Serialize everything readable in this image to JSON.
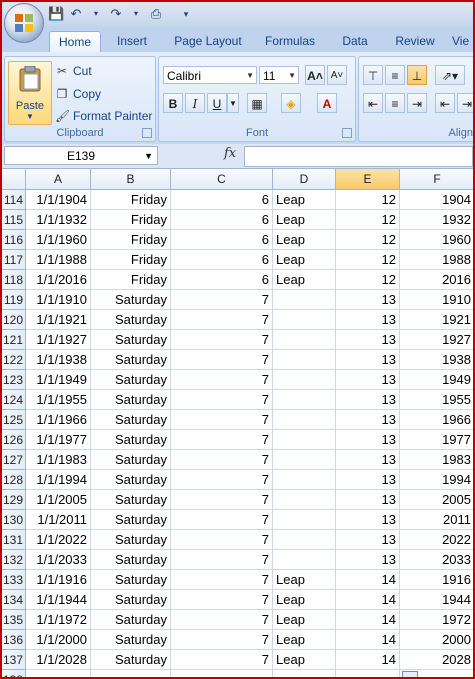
{
  "tabs": [
    "Home",
    "Insert",
    "Page Layout",
    "Formulas",
    "Data",
    "Review",
    "Vie"
  ],
  "ribbon": {
    "clipboard": {
      "paste": "Paste",
      "cut": "Cut",
      "copy": "Copy",
      "format_painter": "Format Painter",
      "label": "Clipboard"
    },
    "font": {
      "name": "Calibri",
      "size": "11",
      "bold": "B",
      "italic": "I",
      "underline": "U",
      "label": "Font"
    },
    "alignment": {
      "label": "Align"
    }
  },
  "formula_bar": {
    "name_box": "E139",
    "fx": "fx",
    "formula": ""
  },
  "columns": [
    "A",
    "B",
    "C",
    "D",
    "E",
    "F"
  ],
  "rows": [
    {
      "n": "114",
      "a": "1/1/1904",
      "b": "Friday",
      "c": "6",
      "d": "Leap",
      "e": "12",
      "f": "1904"
    },
    {
      "n": "115",
      "a": "1/1/1932",
      "b": "Friday",
      "c": "6",
      "d": "Leap",
      "e": "12",
      "f": "1932"
    },
    {
      "n": "116",
      "a": "1/1/1960",
      "b": "Friday",
      "c": "6",
      "d": "Leap",
      "e": "12",
      "f": "1960"
    },
    {
      "n": "117",
      "a": "1/1/1988",
      "b": "Friday",
      "c": "6",
      "d": "Leap",
      "e": "12",
      "f": "1988"
    },
    {
      "n": "118",
      "a": "1/1/2016",
      "b": "Friday",
      "c": "6",
      "d": "Leap",
      "e": "12",
      "f": "2016"
    },
    {
      "n": "119",
      "a": "1/1/1910",
      "b": "Saturday",
      "c": "7",
      "d": "",
      "e": "13",
      "f": "1910"
    },
    {
      "n": "120",
      "a": "1/1/1921",
      "b": "Saturday",
      "c": "7",
      "d": "",
      "e": "13",
      "f": "1921"
    },
    {
      "n": "121",
      "a": "1/1/1927",
      "b": "Saturday",
      "c": "7",
      "d": "",
      "e": "13",
      "f": "1927"
    },
    {
      "n": "122",
      "a": "1/1/1938",
      "b": "Saturday",
      "c": "7",
      "d": "",
      "e": "13",
      "f": "1938"
    },
    {
      "n": "123",
      "a": "1/1/1949",
      "b": "Saturday",
      "c": "7",
      "d": "",
      "e": "13",
      "f": "1949"
    },
    {
      "n": "124",
      "a": "1/1/1955",
      "b": "Saturday",
      "c": "7",
      "d": "",
      "e": "13",
      "f": "1955"
    },
    {
      "n": "125",
      "a": "1/1/1966",
      "b": "Saturday",
      "c": "7",
      "d": "",
      "e": "13",
      "f": "1966"
    },
    {
      "n": "126",
      "a": "1/1/1977",
      "b": "Saturday",
      "c": "7",
      "d": "",
      "e": "13",
      "f": "1977"
    },
    {
      "n": "127",
      "a": "1/1/1983",
      "b": "Saturday",
      "c": "7",
      "d": "",
      "e": "13",
      "f": "1983"
    },
    {
      "n": "128",
      "a": "1/1/1994",
      "b": "Saturday",
      "c": "7",
      "d": "",
      "e": "13",
      "f": "1994"
    },
    {
      "n": "129",
      "a": "1/1/2005",
      "b": "Saturday",
      "c": "7",
      "d": "",
      "e": "13",
      "f": "2005"
    },
    {
      "n": "130",
      "a": "1/1/2011",
      "b": "Saturday",
      "c": "7",
      "d": "",
      "e": "13",
      "f": "2011"
    },
    {
      "n": "131",
      "a": "1/1/2022",
      "b": "Saturday",
      "c": "7",
      "d": "",
      "e": "13",
      "f": "2022"
    },
    {
      "n": "132",
      "a": "1/1/2033",
      "b": "Saturday",
      "c": "7",
      "d": "",
      "e": "13",
      "f": "2033"
    },
    {
      "n": "133",
      "a": "1/1/1916",
      "b": "Saturday",
      "c": "7",
      "d": "Leap",
      "e": "14",
      "f": "1916"
    },
    {
      "n": "134",
      "a": "1/1/1944",
      "b": "Saturday",
      "c": "7",
      "d": "Leap",
      "e": "14",
      "f": "1944"
    },
    {
      "n": "135",
      "a": "1/1/1972",
      "b": "Saturday",
      "c": "7",
      "d": "Leap",
      "e": "14",
      "f": "1972"
    },
    {
      "n": "136",
      "a": "1/1/2000",
      "b": "Saturday",
      "c": "7",
      "d": "Leap",
      "e": "14",
      "f": "2000"
    },
    {
      "n": "137",
      "a": "1/1/2028",
      "b": "Saturday",
      "c": "7",
      "d": "Leap",
      "e": "14",
      "f": "2028"
    },
    {
      "n": "138",
      "a": "",
      "b": "",
      "c": "",
      "d": "",
      "e": "",
      "f": ""
    }
  ],
  "colors": {
    "frame": "#c00000",
    "selected_column": "#f8c967",
    "ribbon": "#d3e2f5"
  }
}
